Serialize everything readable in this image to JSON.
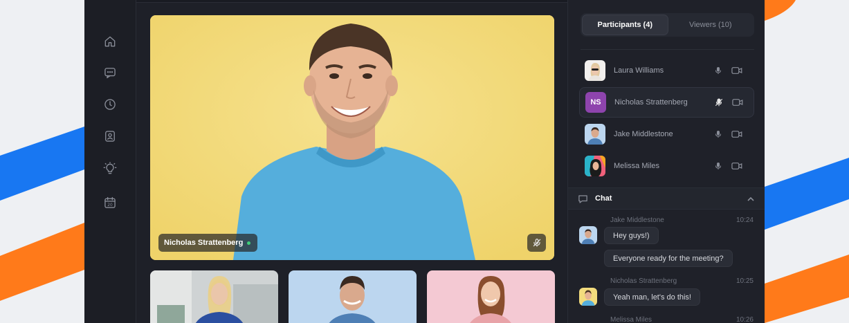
{
  "colors": {
    "accent_orange": "#ff7a1a",
    "accent_blue": "#1877f2",
    "app_bg": "#1e2028",
    "online": "#3fd07a",
    "initials_bg": "#8e44ad"
  },
  "rail": {
    "items": [
      {
        "icon": "home-icon"
      },
      {
        "icon": "chat-icon"
      },
      {
        "icon": "clock-icon"
      },
      {
        "icon": "contacts-icon"
      },
      {
        "icon": "lightbulb-icon"
      },
      {
        "icon": "calendar-icon",
        "text": "20"
      }
    ]
  },
  "stage": {
    "speaker_name": "Nicholas Strattenberg",
    "muted_icon": "mic-off-icon"
  },
  "panel": {
    "tabs": [
      {
        "label": "Participants (4)",
        "active": true
      },
      {
        "label": "Viewers (10)",
        "active": false
      }
    ],
    "participants": [
      {
        "name": "Laura Williams",
        "mic": "mic-icon",
        "cam": "camera-icon"
      },
      {
        "name": "Nicholas Strattenberg",
        "initials": "NS",
        "mic": "mic-off-icon",
        "cam": "camera-icon"
      },
      {
        "name": "Jake Middlestone",
        "mic": "mic-icon",
        "cam": "camera-icon"
      },
      {
        "name": "Melissa Miles",
        "mic": "mic-icon",
        "cam": "camera-icon"
      }
    ],
    "chat": {
      "title": "Chat",
      "messages": [
        {
          "sender": "Jake Middlestone",
          "time": "10:24",
          "lines": [
            "Hey guys!)",
            "Everyone ready for the meeting?"
          ]
        },
        {
          "sender": "Nicholas Strattenberg",
          "time": "10:25",
          "lines": [
            "Yeah man, let's do this!"
          ]
        },
        {
          "sender": "Melissa Miles",
          "time": "10:26",
          "lines": []
        }
      ]
    }
  }
}
